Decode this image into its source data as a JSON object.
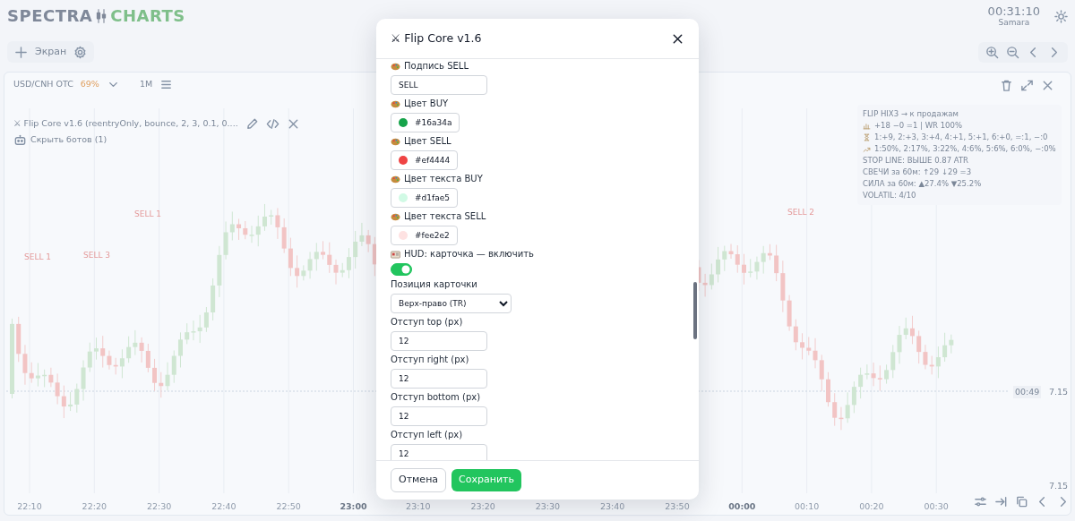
{
  "header": {
    "logo_left": "SPECTRA",
    "logo_right": "CHARTS",
    "clock": "00:31:10",
    "timezone": "Samara"
  },
  "toolbar": {
    "add_screen": "Экран"
  },
  "chart_panel": {
    "symbol": "USD/CNH OTC",
    "payout": "69%",
    "timeframe": "1M",
    "bot_line": "⚔ Flip Core v1.6 (reentryOnly, bounce, 2, 3, 0.1, 0....",
    "hide_bots": "Скрыть ботов (1)",
    "signals": [
      {
        "label": "SELL 1"
      },
      {
        "label": "SELL 3"
      },
      {
        "label": "SELL 1"
      },
      {
        "label": "SELL 2"
      }
    ],
    "hud": [
      {
        "text": "FLIP HIX3 → к продажам"
      },
      {
        "text": "+18 −0 =1 | WR 100%"
      },
      {
        "text": "1:+9, 2:+3, 3:+4, 4:+1, 5:+1, 6:+0, =:1, −:0"
      },
      {
        "text": "1:50%, 2:17%, 3:22%, 4:6%, 5:6%, 6:0%, −:0%"
      },
      {
        "text": "STOP LINE: ВЫШЕ 0.87 ATR"
      },
      {
        "text": "СВЕЧИ за 60м: ↑29 ↓29 =3"
      },
      {
        "text": "СИЛА за 60м: ▲27.4% ▼25.2%"
      },
      {
        "text": "VOLATIL: 4/10"
      }
    ],
    "time_axis": [
      {
        "label": "22:10",
        "major": false
      },
      {
        "label": "22:20",
        "major": false
      },
      {
        "label": "22:30",
        "major": false
      },
      {
        "label": "22:40",
        "major": false
      },
      {
        "label": "22:50",
        "major": false
      },
      {
        "label": "23:00",
        "major": true
      },
      {
        "label": "23:10",
        "major": false
      },
      {
        "label": "23:20",
        "major": false
      },
      {
        "label": "23:30",
        "major": false
      },
      {
        "label": "23:40",
        "major": false
      },
      {
        "label": "23:50",
        "major": false
      },
      {
        "label": "00:00",
        "major": true
      },
      {
        "label": "00:10",
        "major": false
      },
      {
        "label": "00:20",
        "major": false
      },
      {
        "label": "00:30",
        "major": false
      }
    ],
    "countdown": "00:49",
    "last_price": "7.15",
    "scale_price": "7.15"
  },
  "modal": {
    "title": "⚔ Flip Core v1.6",
    "fields": [
      {
        "kind": "text",
        "label": "Подпись SELL",
        "value": "SELL"
      },
      {
        "kind": "color",
        "label": "Цвет BUY",
        "value": "#16a34a",
        "color": "#16a34a"
      },
      {
        "kind": "color",
        "label": "Цвет SELL",
        "value": "#ef4444",
        "color": "#ef4444"
      },
      {
        "kind": "color",
        "label": "Цвет текста BUY",
        "value": "#d1fae5",
        "color": "#d1fae5"
      },
      {
        "kind": "color",
        "label": "Цвет текста SELL",
        "value": "#fee2e2",
        "color": "#fee2e2"
      },
      {
        "kind": "toggle",
        "label": "HUD: карточка — включить",
        "on": true
      },
      {
        "kind": "select",
        "label": "Позиция карточки",
        "value": "Верх-право (TR)"
      },
      {
        "kind": "text",
        "label": "Отступ top (px)",
        "value": "12"
      },
      {
        "kind": "text",
        "label": "Отступ right (px)",
        "value": "12"
      },
      {
        "kind": "text",
        "label": "Отступ bottom (px)",
        "value": "12"
      },
      {
        "kind": "text",
        "label": "Отступ left (px)",
        "value": "12"
      }
    ],
    "cancel": "Отмена",
    "save": "Сохранить"
  }
}
